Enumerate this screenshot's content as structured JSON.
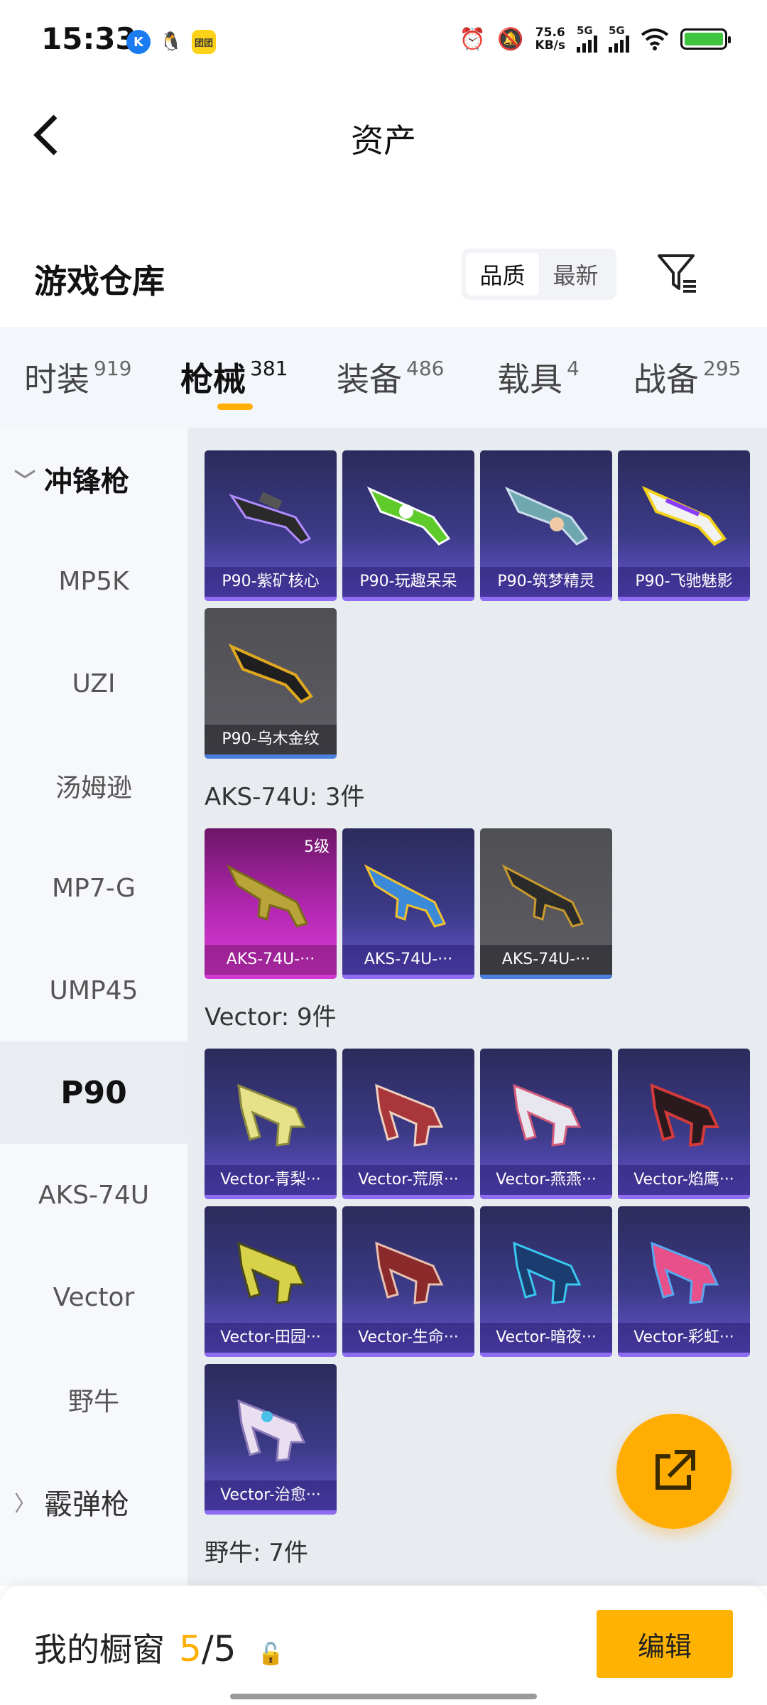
{
  "status_bar": {
    "time": "15:33",
    "speed_value": "75.6",
    "speed_unit": "KB/s",
    "sim1": "5G",
    "sim2": "5G",
    "battery_level": 1.0,
    "app_icons": [
      "kuaishou-icon",
      "qq-icon",
      "tuan-icon"
    ],
    "app_k_letter": "K",
    "app_y_text": "团团"
  },
  "header": {
    "title": "资产"
  },
  "warehouse": {
    "title": "游戏仓库",
    "sort_options": [
      "品质",
      "最新"
    ],
    "sort_selected": "品质"
  },
  "tabs": [
    {
      "label": "时装",
      "count": "919"
    },
    {
      "label": "枪械",
      "count": "381",
      "active": true
    },
    {
      "label": "装备",
      "count": "486"
    },
    {
      "label": "载具",
      "count": "4"
    },
    {
      "label": "战备",
      "count": "295"
    }
  ],
  "sidebar": {
    "items": [
      {
        "label": "冲锋枪",
        "type": "group",
        "expanded": true
      },
      {
        "label": "MP5K"
      },
      {
        "label": "UZI"
      },
      {
        "label": "汤姆逊"
      },
      {
        "label": "MP7-G"
      },
      {
        "label": "UMP45"
      },
      {
        "label": "P90",
        "selected": true
      },
      {
        "label": "AKS-74U"
      },
      {
        "label": "Vector"
      },
      {
        "label": "野牛"
      },
      {
        "label": "霰弹枪",
        "type": "group",
        "expanded": false
      }
    ]
  },
  "main": {
    "p90_cards": [
      {
        "name": "P90-紫矿核心",
        "tier": "purple"
      },
      {
        "name": "P90-玩趣呆呆",
        "tier": "purple"
      },
      {
        "name": "P90-筑梦精灵",
        "tier": "purple"
      },
      {
        "name": "P90-飞驰魅影",
        "tier": "purple"
      },
      {
        "name": "P90-乌木金纹",
        "tier": "gray"
      }
    ],
    "aks_section": "AKS-74U: 3件",
    "aks_cards": [
      {
        "name": "AKS-74U-···",
        "tier": "pink",
        "level": "5级"
      },
      {
        "name": "AKS-74U-···",
        "tier": "purple"
      },
      {
        "name": "AKS-74U-···",
        "tier": "gray"
      }
    ],
    "vector_section": "Vector: 9件",
    "vector_cards": [
      {
        "name": "Vector-青梨···",
        "tier": "purple"
      },
      {
        "name": "Vector-荒原···",
        "tier": "purple"
      },
      {
        "name": "Vector-燕燕···",
        "tier": "purple"
      },
      {
        "name": "Vector-焰鹰···",
        "tier": "purple"
      },
      {
        "name": "Vector-田园···",
        "tier": "purple"
      },
      {
        "name": "Vector-生命···",
        "tier": "purple"
      },
      {
        "name": "Vector-暗夜···",
        "tier": "purple"
      },
      {
        "name": "Vector-彩虹···",
        "tier": "purple"
      },
      {
        "name": "Vector-治愈···",
        "tier": "purple"
      }
    ],
    "bison_section": "野牛: 7件"
  },
  "bottom": {
    "showcase_label": "我的橱窗",
    "showcase_current": "5",
    "showcase_sep": "/",
    "showcase_total": "5",
    "edit_label": "编辑"
  },
  "colors": {
    "accent": "#ffb000",
    "card_purple": "#3b3a86",
    "card_gray": "#5d5d63",
    "card_pink": "#b528b4"
  }
}
